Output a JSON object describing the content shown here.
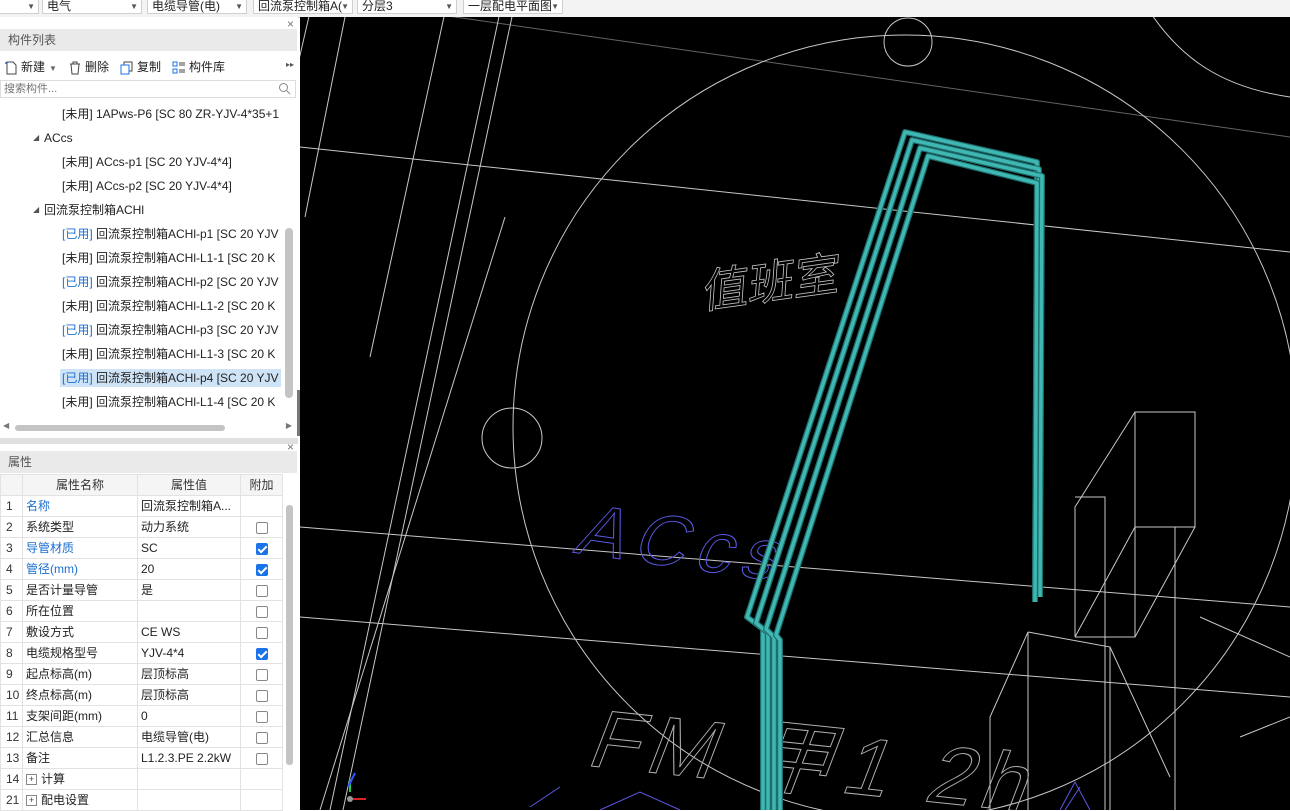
{
  "toolbar": {
    "dropdowns": [
      {
        "value": ""
      },
      {
        "value": "电气"
      },
      {
        "value": "电缆导管(电)"
      },
      {
        "value": "回流泵控制箱A("
      },
      {
        "value": "分层3"
      },
      {
        "value": "一层配电平面图"
      }
    ]
  },
  "component_panel": {
    "title": "构件列表",
    "close": "×",
    "actions": {
      "new": "新建",
      "delete": "删除",
      "copy": "复制",
      "library": "构件库"
    },
    "search_placeholder": "搜索构件...",
    "tree": [
      {
        "tag": "[未用]",
        "text": " 1APws-P6 [SC 80 ZR-YJV-4*35+1"
      },
      {
        "group": "ACcs"
      },
      {
        "tag": "[未用]",
        "text": " ACcs-p1 [SC 20 YJV-4*4]"
      },
      {
        "tag": "[未用]",
        "text": " ACcs-p2 [SC 20 YJV-4*4]"
      },
      {
        "group": "回流泵控制箱ACHl"
      },
      {
        "tag": "[已用]",
        "text": " 回流泵控制箱ACHl-p1 [SC 20 YJV"
      },
      {
        "tag": "[未用]",
        "text": " 回流泵控制箱ACHl-L1-1 [SC 20 K"
      },
      {
        "tag": "[已用]",
        "text": " 回流泵控制箱ACHl-p2 [SC 20 YJV"
      },
      {
        "tag": "[未用]",
        "text": " 回流泵控制箱ACHl-L1-2 [SC 20 K"
      },
      {
        "tag": "[已用]",
        "text": " 回流泵控制箱ACHl-p3 [SC 20 YJV"
      },
      {
        "tag": "[未用]",
        "text": " 回流泵控制箱ACHl-L1-3 [SC 20 K"
      },
      {
        "tag": "[已用]",
        "text": " 回流泵控制箱ACHl-p4 [SC 20 YJV"
      },
      {
        "tag": "[未用]",
        "text": " 回流泵控制箱ACHl-L1-4 [SC 20 K"
      }
    ]
  },
  "property_panel": {
    "title": "属性",
    "close": "×",
    "headers": [
      "属性名称",
      "属性值",
      "附加"
    ],
    "rows": [
      {
        "num": "1",
        "name": "名称",
        "value": "回流泵控制箱A...",
        "blue": true,
        "check": null
      },
      {
        "num": "2",
        "name": "系统类型",
        "value": "动力系统",
        "blue": false,
        "check": false
      },
      {
        "num": "3",
        "name": "导管材质",
        "value": "SC",
        "blue": true,
        "check": true
      },
      {
        "num": "4",
        "name": "管径(mm)",
        "value": "20",
        "blue": true,
        "check": true
      },
      {
        "num": "5",
        "name": "是否计量导管",
        "value": "是",
        "blue": false,
        "check": false
      },
      {
        "num": "6",
        "name": "所在位置",
        "value": "",
        "blue": false,
        "check": false
      },
      {
        "num": "7",
        "name": "敷设方式",
        "value": "CE WS",
        "blue": false,
        "check": false
      },
      {
        "num": "8",
        "name": "电缆规格型号",
        "value": "YJV-4*4",
        "blue": false,
        "check": true
      },
      {
        "num": "9",
        "name": "起点标高(m)",
        "value": "层顶标高",
        "blue": false,
        "check": false
      },
      {
        "num": "10",
        "name": "终点标高(m)",
        "value": "层顶标高",
        "blue": false,
        "check": false
      },
      {
        "num": "11",
        "name": "支架间距(mm)",
        "value": "0",
        "blue": false,
        "check": false
      },
      {
        "num": "12",
        "name": "汇总信息",
        "value": "电缆导管(电)",
        "blue": false,
        "check": false
      },
      {
        "num": "13",
        "name": "备注",
        "value": "L1.2.3.PE 2.2kW",
        "blue": false,
        "check": false
      },
      {
        "num": "14",
        "name": "计算",
        "value": "",
        "group": true
      },
      {
        "num": "21",
        "name": "配电设置",
        "value": "",
        "group": true
      }
    ]
  },
  "viewport": {
    "labels": {
      "room": "值班室",
      "accs": "ACcs",
      "fm": "FM 甲1 2h"
    },
    "colors": {
      "background": "#000000",
      "pipe": "#3fb8b4",
      "line": "#c8c8c8",
      "text_blue": "#5a5ae6"
    }
  }
}
